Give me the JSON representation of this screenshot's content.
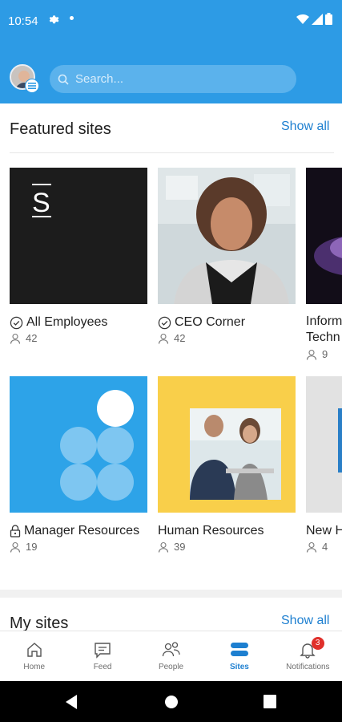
{
  "status": {
    "time": "10:54"
  },
  "header": {
    "search_placeholder": "Search..."
  },
  "featured": {
    "title": "Featured sites",
    "show_all": "Show all",
    "sites": [
      {
        "name": "All Employees",
        "members": "42",
        "icon": "check-circle-icon"
      },
      {
        "name": "CEO Corner",
        "members": "42",
        "icon": "check-circle-icon"
      },
      {
        "name_line1": "Inform",
        "name_line2": "Techn",
        "members": "9"
      },
      {
        "name": "Manager Resources",
        "members": "19",
        "icon": "lock-icon"
      },
      {
        "name": "Human Resources",
        "members": "39"
      },
      {
        "name": "New H",
        "members": "4"
      }
    ],
    "tile_logo_letter": "S"
  },
  "my_sites": {
    "title": "My sites",
    "show_all": "Show all"
  },
  "tabs": [
    {
      "label": "Home",
      "icon": "home-icon"
    },
    {
      "label": "Feed",
      "icon": "feed-icon"
    },
    {
      "label": "People",
      "icon": "people-icon"
    },
    {
      "label": "Sites",
      "icon": "sites-icon",
      "active": true
    },
    {
      "label": "Notifications",
      "icon": "bell-icon",
      "badge": "3"
    }
  ],
  "colors": {
    "accent": "#2d9be5",
    "link": "#1d7fd0",
    "tile_blue": "#2da3e8",
    "tile_yellow": "#f9cf4a",
    "badge": "#e0302b"
  }
}
